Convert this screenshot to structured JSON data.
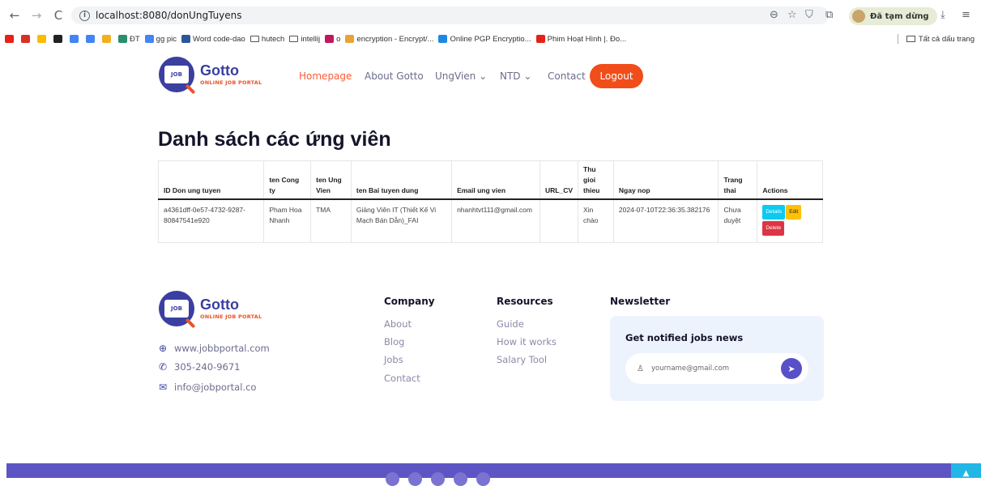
{
  "browser": {
    "url": "localhost:8080/donUngTuyens",
    "paused_label": "Đã tạm dừng",
    "bookmarks": [
      {
        "label": "",
        "icon": "youtube-icon",
        "color": "#e62117"
      },
      {
        "label": "",
        "icon": "gmail-icon",
        "color": "#d93025"
      },
      {
        "label": "",
        "icon": "apps-icon",
        "color": "#fbbc04"
      },
      {
        "label": "",
        "icon": "openai-icon",
        "color": "#222222"
      },
      {
        "label": "",
        "icon": "translate-icon",
        "color": "#4285f4"
      },
      {
        "label": "",
        "icon": "google-icon",
        "color": "#4285f4"
      },
      {
        "label": "",
        "icon": "badge-icon",
        "color": "#f2b01e"
      },
      {
        "label": "ĐT",
        "icon": "phone-icon",
        "color": "#2a8f6b"
      },
      {
        "label": "gg pic",
        "icon": "google-icon",
        "color": "#4285f4"
      },
      {
        "label": "Word code-dao",
        "icon": "word-icon",
        "color": "#2b579a"
      },
      {
        "label": "hutech",
        "icon": "folder-icon",
        "color": ""
      },
      {
        "label": "intellij",
        "icon": "folder-icon",
        "color": ""
      },
      {
        "label": "o",
        "icon": "app-icon",
        "color": "#c2185b"
      },
      {
        "label": "encryption - Encrypt/...",
        "icon": "key-icon",
        "color": "#e9a23b"
      },
      {
        "label": "Online PGP Encryptio...",
        "icon": "pgp-icon",
        "color": "#1e88e5"
      },
      {
        "label": "Phim Hoạt Hình |. Đo...",
        "icon": "video-icon",
        "color": "#e62117"
      }
    ],
    "all_bookmarks_label": "Tất cả dấu trang"
  },
  "brand": {
    "name": "Gotto",
    "tagline": "ONLINE JOB PORTAL",
    "logo_text": "JOB",
    "primary_color": "#3a3fa0",
    "accent_color": "#e8552a"
  },
  "nav": {
    "items": [
      {
        "label": "Homepage",
        "active": true
      },
      {
        "label": "About Gotto"
      },
      {
        "label": "UngVien ⌄"
      },
      {
        "label": "NTD ⌄"
      },
      {
        "label": "Contact"
      }
    ],
    "logout_label": "Logout"
  },
  "page": {
    "title": "Danh sách các ứng viên"
  },
  "table": {
    "headers": [
      "ID Don ung tuyen",
      "ten Cong ty",
      "ten Ung Vien",
      "ten Bai tuyen dung",
      "Email ung vien",
      "URL_CV",
      "Thu gioi thieu",
      "Ngay nop",
      "Trang thai",
      "Actions"
    ],
    "rows": [
      {
        "cells": [
          "a4361dff-0e57-4732-9287-80847541e920",
          "Pham Hoa Nhanh",
          "TMA",
          "Giảng Viên IT (Thiết Kế Vi Mạch Bán Dẫn)_FAI",
          "nhanhtvt111@gmail.com",
          "",
          "Xin chào",
          "2024-07-10T22:36:35.382176",
          "Chưa duyệt"
        ],
        "actions": {
          "details": "Details",
          "edit": "Edit",
          "delete": "Delete"
        }
      }
    ]
  },
  "footer": {
    "website": "www.jobbportal.com",
    "phone": "305-240-9671",
    "email": "info@jobportal.co",
    "company": {
      "title": "Company",
      "links": [
        "About",
        "Blog",
        "Jobs",
        "Contact"
      ]
    },
    "resources": {
      "title": "Resources",
      "links": [
        "Guide",
        "How it works",
        "Salary Tool"
      ]
    },
    "newsletter": {
      "title": "Newsletter",
      "box_title": "Get notified jobs news",
      "placeholder": "yourname@gmail.com"
    },
    "bar_color": "#5d55c3"
  }
}
